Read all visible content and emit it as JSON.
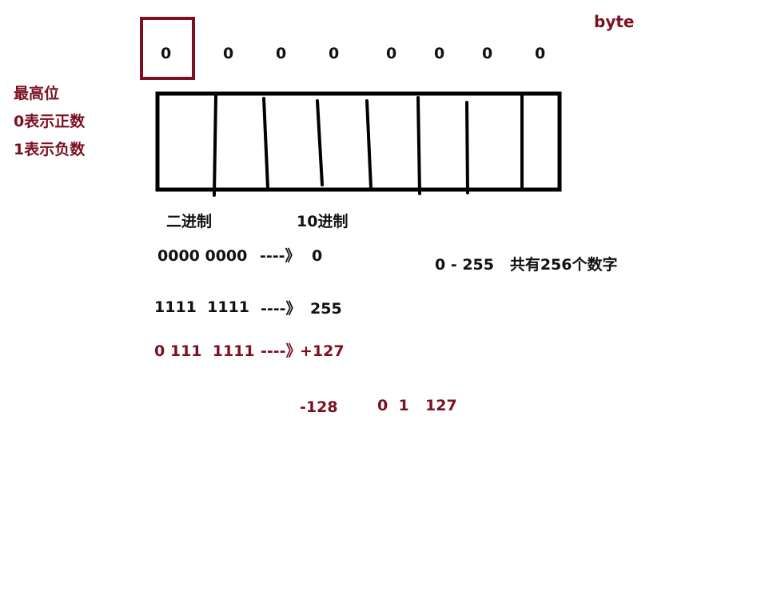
{
  "colors": {
    "ink": "#111111",
    "accent": "#7a1020"
  },
  "title": "byte",
  "bits": [
    "0",
    "0",
    "0",
    "0",
    "0",
    "0",
    "0",
    "0"
  ],
  "highlighted_bit_index": 0,
  "sign_note": {
    "line1": "最高位",
    "line2": "0表示正数",
    "line3": "1表示负数"
  },
  "headers": {
    "binary": "二进制",
    "decimal": "10进制"
  },
  "rows": [
    {
      "binary": "0000 0000",
      "arrow": "----》",
      "decimal": "0"
    },
    {
      "binary": "1111  1111",
      "arrow": "----》",
      "decimal": "255"
    },
    {
      "binary": "0 111  1111",
      "arrow": "----》",
      "decimal": "+127"
    }
  ],
  "range_note": "0 - 255   共有256个数字",
  "signed_range": {
    "min": "-128",
    "zero_one": "0  1",
    "max": "127"
  }
}
